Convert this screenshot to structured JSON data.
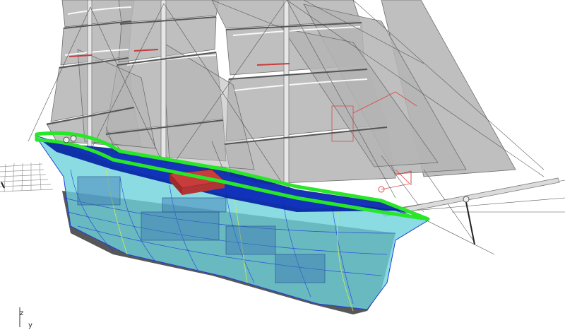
{
  "viewport": {
    "axis_labels": {
      "z": "z",
      "y": "y"
    },
    "colors": {
      "background": "#ffffff",
      "sail_fill": "#b4b4b4",
      "sail_edge": "#6e6e6e",
      "hull_fill": "#6ed2dc",
      "hull_lines": "#1e3cdc",
      "deck": "#001ea0",
      "selection_highlight": "#28e628",
      "deck_house": "#c83c3c",
      "rigging": "#555555",
      "construction_plane": "#9a9a9a"
    }
  }
}
